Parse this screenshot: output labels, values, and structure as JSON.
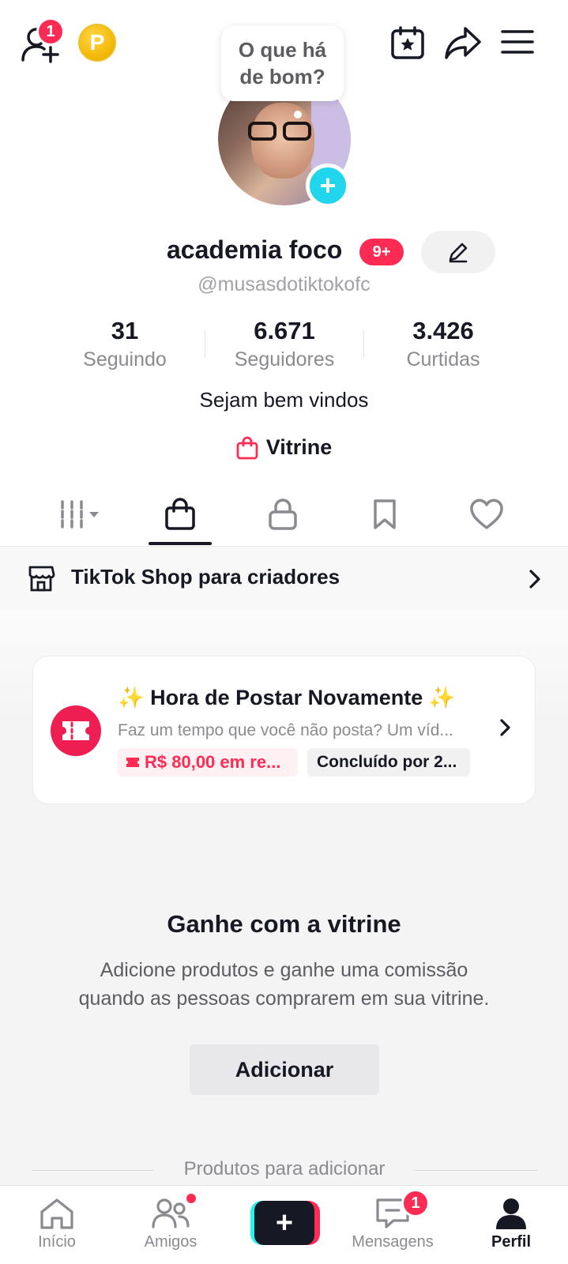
{
  "header": {
    "friends_badge": "1",
    "coin_letter": "P",
    "story_prompt_line1": "O que há",
    "story_prompt_line2": "de bom?"
  },
  "profile": {
    "name": "academia foco",
    "notification_badge": "9+",
    "handle": "@musasdotiktokofc",
    "bio": "Sejam bem vindos",
    "vitrine_label": "Vitrine"
  },
  "stats": [
    {
      "value": "31",
      "label": "Seguindo"
    },
    {
      "value": "6.671",
      "label": "Seguidores"
    },
    {
      "value": "3.426",
      "label": "Curtidas"
    }
  ],
  "tabs": [
    "videos-grid",
    "vitrine",
    "private",
    "saved",
    "liked"
  ],
  "shop_row": {
    "label": "TikTok Shop para criadores"
  },
  "task_card": {
    "title": "✨ Hora de Postar Novamente ✨",
    "subtitle": "Faz um tempo que você não posta? Um víd...",
    "reward": "R$ 80,00 em re...",
    "due": "Concluído por 2..."
  },
  "promo": {
    "title": "Ganhe com a vitrine",
    "desc_line1": "Adicione produtos e ganhe uma comissão",
    "desc_line2": "quando as pessoas comprarem em sua vitrine.",
    "button": "Adicionar",
    "section_label": "Produtos para adicionar"
  },
  "bottom_nav": {
    "home": "Início",
    "friends": "Amigos",
    "messages": "Mensagens",
    "messages_badge": "1",
    "profile": "Perfil"
  },
  "colors": {
    "accent": "#fe2c55",
    "cyan": "#25f4ee",
    "text": "#161823",
    "muted": "#8a8b91"
  }
}
